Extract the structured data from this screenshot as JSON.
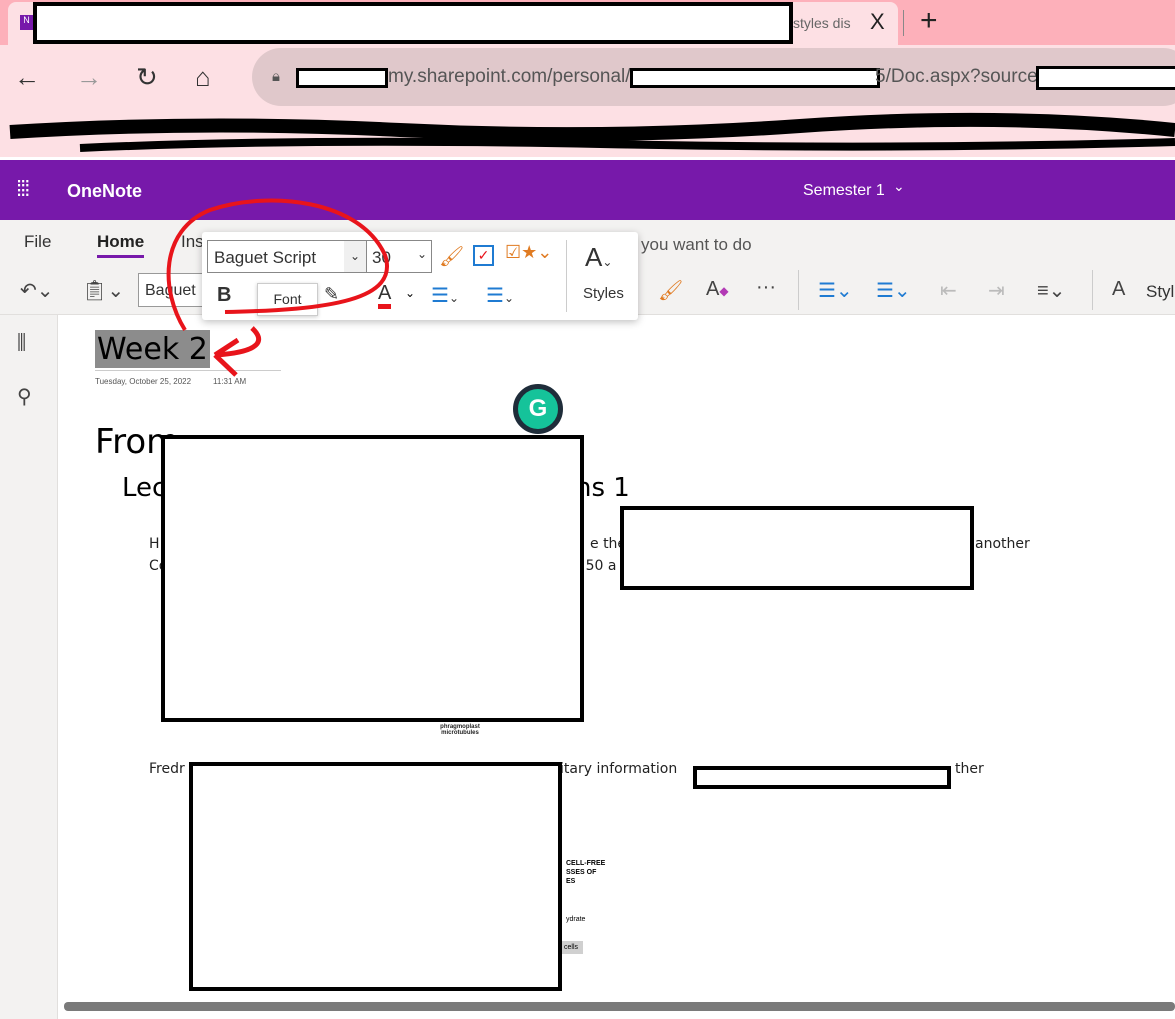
{
  "browser": {
    "tab_title_fragment": "styles dis",
    "tab_close": "X",
    "new_tab": "+",
    "url_host": "my.sharepoint.com/personal/",
    "url_path": "5/Doc.aspx?sourced"
  },
  "app": {
    "name": "OneNote",
    "notebook": "Semester 1",
    "notebook_chevron": "⌄"
  },
  "ribbon": {
    "tabs": [
      {
        "label": "File"
      },
      {
        "label": "Home",
        "active": true
      },
      {
        "label": "Ins"
      }
    ],
    "tell_me": "you want to do",
    "font_fragment": "Baguet",
    "styles_label": "Styl"
  },
  "floating_toolbar": {
    "font_name": "Baguet Script",
    "font_size": "30",
    "bold": "B",
    "tooltip": "Font",
    "styles_label": "Styles"
  },
  "page": {
    "title": "Week 2",
    "date": "Tuesday, October 25, 2022",
    "time": "11:31 AM",
    "heading_fragment": "From",
    "subheading_start": "Lec",
    "subheading_end": "ns 1",
    "para1_start_line1": "H",
    "para1_mid_line1": "e the",
    "para1_end_line1": "another",
    "para1_start_line2": "Co",
    "para1_mid_line2": "0:50 a",
    "image1_caption_line1": "phragmoplast",
    "image1_caption_line2": "microtubules",
    "para2_start": "Fredr",
    "para2_mid": "itary information",
    "para2_end": "ther",
    "image2_labels": [
      "CELL-FREE",
      "SSES OF",
      "ES",
      "ydrate",
      "cells"
    ]
  },
  "colors": {
    "brand": "#7719aa",
    "annotation": "#e8141b",
    "tab_bg": "#fdb0ba",
    "grammarly": "#15c39a"
  }
}
